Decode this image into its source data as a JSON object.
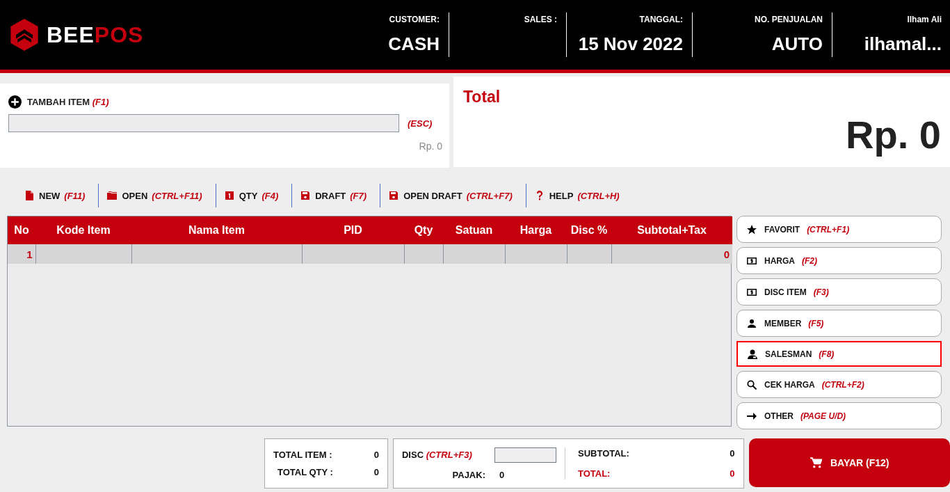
{
  "header": {
    "logo": {
      "part_1": "BEE",
      "part_2": "POS"
    },
    "fields": [
      {
        "label": "CUSTOMER:",
        "value": "CASH"
      },
      {
        "label": "SALES :"
      },
      {
        "label": "TANGGAL:",
        "value": "15 Nov 2022"
      },
      {
        "label": "NO. PENJUALAN",
        "value": "AUTO"
      },
      {
        "label": "Ilham Ali",
        "value": "ilhamal..."
      }
    ]
  },
  "add_item": {
    "label": "TAMBAH ITEM",
    "shortcut": "(F1)",
    "clear_shortcut": "(ESC)",
    "price": "Rp. 0"
  },
  "total": {
    "title": "Total",
    "amount": "Rp. 0"
  },
  "toolbar": [
    {
      "kind": "new",
      "label": "NEW",
      "shortcut": "(F11)"
    },
    {
      "kind": "open",
      "label": "OPEN",
      "shortcut": "(CTRL+F11)"
    },
    {
      "kind": "qty",
      "label": "QTY",
      "shortcut": "(F4)"
    },
    {
      "kind": "draft",
      "label": "DRAFT",
      "shortcut": "(F7)"
    },
    {
      "kind": "draft",
      "label": "OPEN DRAFT",
      "shortcut": "(CTRL+F7)"
    },
    {
      "kind": "help",
      "label": "HELP",
      "shortcut": "(CTRL+H)"
    }
  ],
  "table": {
    "columns": [
      "No",
      "Kode Item",
      "Nama Item",
      "PID",
      "Qty",
      "Satuan",
      "Harga",
      "Disc %",
      "Subtotal+Tax"
    ],
    "rows": [
      {
        "no": "1",
        "subtotal_tax": "0"
      }
    ]
  },
  "side_buttons": [
    {
      "kind": "favorite",
      "label": "FAVORIT",
      "shortcut": "(CTRL+F1)",
      "focused": false
    },
    {
      "kind": "price",
      "label": "HARGA",
      "shortcut": "(F2)",
      "focused": false
    },
    {
      "kind": "price",
      "label": "DISC ITEM",
      "shortcut": "(F3)",
      "focused": false
    },
    {
      "kind": "member",
      "label": "MEMBER",
      "shortcut": "(F5)",
      "focused": false
    },
    {
      "kind": "salesman",
      "label": "SALESMAN",
      "shortcut": "(F8)",
      "focused": true
    },
    {
      "kind": "lookup",
      "label": "CEK HARGA",
      "shortcut": "(CTRL+F2)",
      "focused": false
    },
    {
      "kind": "other",
      "label": "OTHER",
      "shortcut": "(PAGE U/D)",
      "focused": false
    }
  ],
  "summary": {
    "total_item_label": "TOTAL ITEM :",
    "total_item": "0",
    "total_qty_label": "TOTAL QTY :",
    "total_qty": "0",
    "disc_label": "DISC",
    "disc_shortcut": "(CTRL+F3)",
    "tax_label": "PAJAK:",
    "tax": "0",
    "subtotal_label": "SUBTOTAL:",
    "subtotal": "0",
    "total_label": "TOTAL:",
    "total": "0"
  },
  "pay_button": {
    "label": "BAYAR (F12)"
  }
}
